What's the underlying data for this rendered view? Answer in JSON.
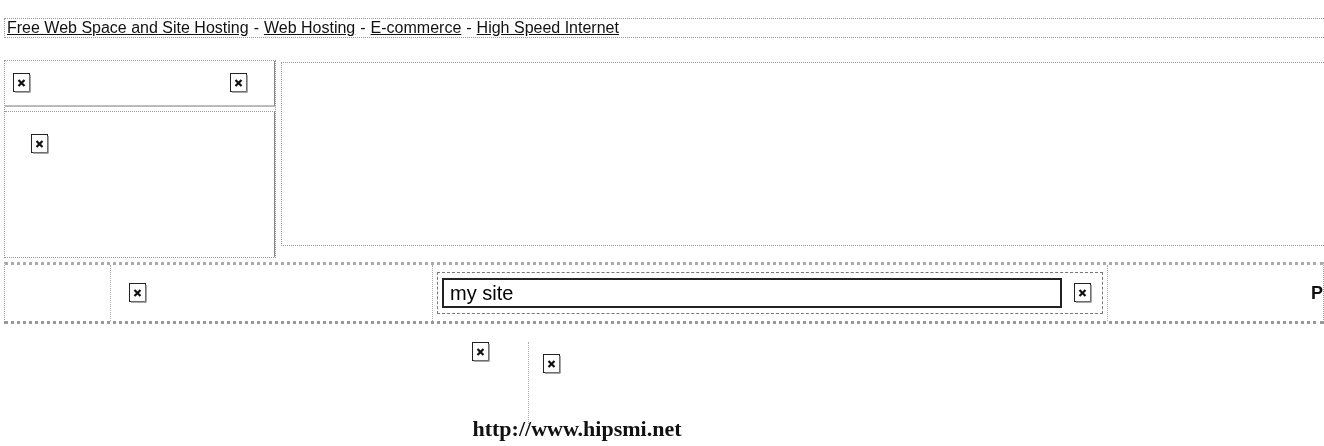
{
  "nav": [
    {
      "kind": "link",
      "text": "Free Web Space and Site Hosting"
    },
    {
      "kind": "text",
      "text": "-"
    },
    {
      "kind": "link",
      "text": "Web Hosting"
    },
    {
      "kind": "text",
      "text": "-"
    },
    {
      "kind": "link",
      "text": "E-commerce"
    },
    {
      "kind": "text",
      "text": "-"
    },
    {
      "kind": "link",
      "text": "High Speed Internet"
    }
  ],
  "search": {
    "value": "my site"
  },
  "cut_text": "P",
  "footer": {
    "url": "http://www.hipsmi.net"
  }
}
